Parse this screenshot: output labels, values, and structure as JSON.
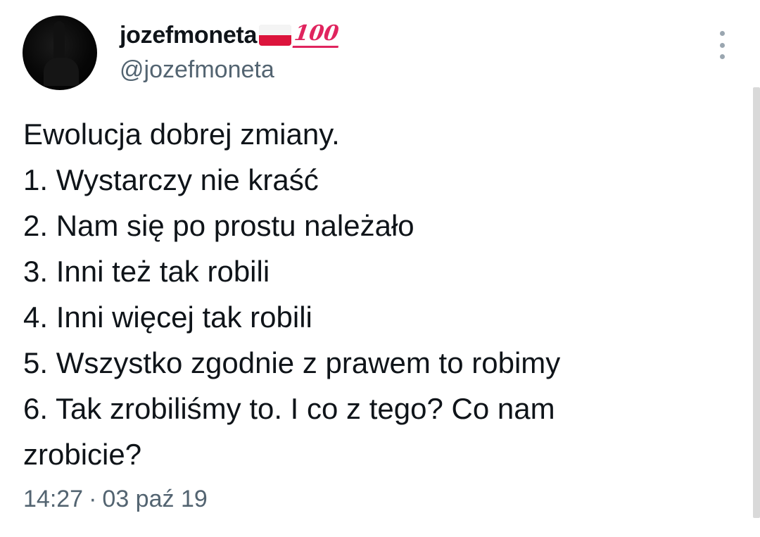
{
  "tweet": {
    "display_name": "jozefmoneta",
    "emoji_flag": "polish-flag",
    "emoji_hundred": "100",
    "handle": "@jozefmoneta",
    "lines": [
      "Ewolucja dobrej zmiany.",
      "1. Wystarczy nie kraść",
      "2. Nam się po prostu należało",
      "3. Inni też tak robili",
      "4. Inni więcej tak robili",
      "5. Wszystko zgodnie z prawem to robimy",
      "6. Tak zrobiliśmy to. I co z tego? Co nam",
      "zrobicie?"
    ],
    "time": "14:27",
    "separator": "·",
    "date": "03 paź 19"
  },
  "icons": {
    "more": "more-vertical-icon"
  },
  "colors": {
    "text": "#0f1419",
    "secondary": "#536471",
    "flag_red": "#dc143c",
    "hundred": "#e0245e"
  }
}
